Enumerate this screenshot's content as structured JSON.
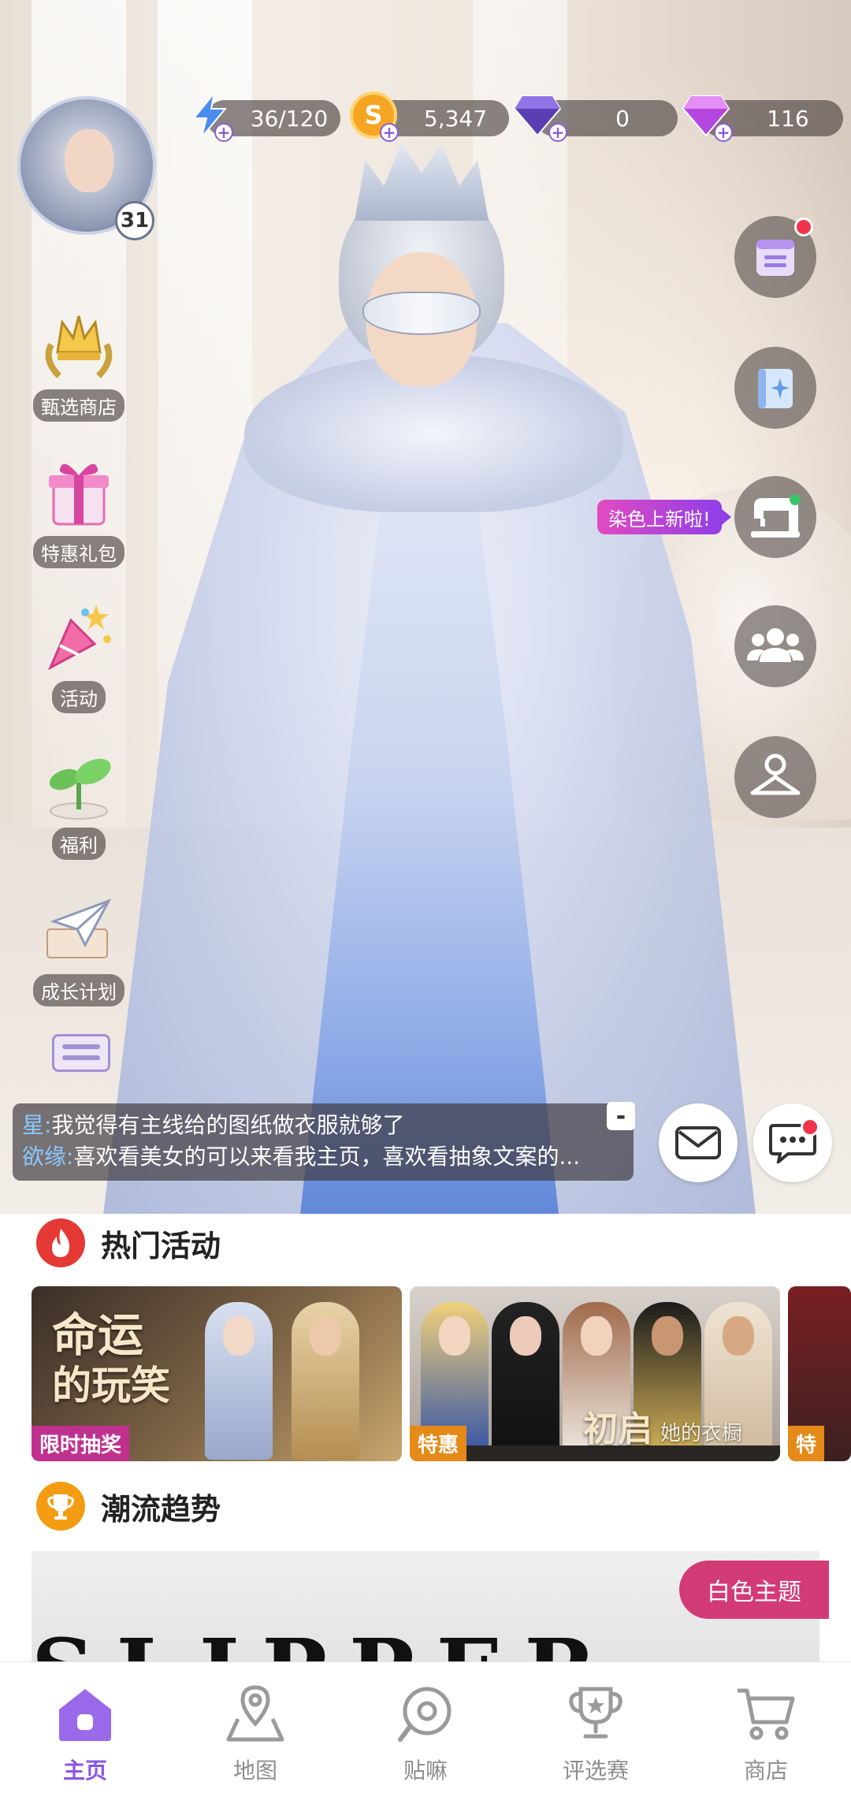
{
  "resources": {
    "energy": "36/120",
    "coins": "5,347",
    "diamonds": "0",
    "gems": "116"
  },
  "profile": {
    "level": "31"
  },
  "left_menu": [
    {
      "label": "甄选商店",
      "icon": "laurel-crown-icon"
    },
    {
      "label": "特惠礼包",
      "icon": "gift-box-icon"
    },
    {
      "label": "活动",
      "icon": "party-popper-icon"
    },
    {
      "label": "福利",
      "icon": "sprout-icon"
    },
    {
      "label": "成长计划",
      "icon": "paper-plane-icon"
    }
  ],
  "right_menu": {
    "dye_tip": "染色上新啦!",
    "icons": [
      "calendar-icon",
      "sparkle-book-icon",
      "sewing-machine-icon",
      "group-icon",
      "hanger-profile-icon"
    ]
  },
  "chat": {
    "lines": [
      {
        "name": "星:",
        "text": "我觉得有主线给的图纸做衣服就够了"
      },
      {
        "name": "欲缘:",
        "text": "喜欢看美女的可以来看我主页，喜欢看抽象文案的..."
      }
    ],
    "collapse_label": "-"
  },
  "hot_activities": {
    "title": "热门活动",
    "banners": [
      {
        "title_line1": "命运",
        "title_line2": "的玩笑",
        "tag": "限时抽奖",
        "tag_color": "#c0318f"
      },
      {
        "title": "初启",
        "subtitle": "她的衣橱",
        "tag": "特惠",
        "tag_color": "#e58a19"
      },
      {
        "tag": "特",
        "tag_color": "#e58a19"
      }
    ]
  },
  "trends": {
    "title": "潮流趋势",
    "tag": "白色主题",
    "headline": "SLIPPER"
  },
  "bottom_nav": [
    {
      "label": "主页",
      "active": true
    },
    {
      "label": "地图",
      "active": false
    },
    {
      "label": "贴嘛",
      "active": false
    },
    {
      "label": "评选赛",
      "active": false
    },
    {
      "label": "商店",
      "active": false
    }
  ],
  "colors": {
    "accent": "#8a56e0",
    "notification": "#f0354b",
    "hot_icon": "#e53935",
    "trend_icon": "#f39c12",
    "trend_tag": "#d33a78"
  }
}
